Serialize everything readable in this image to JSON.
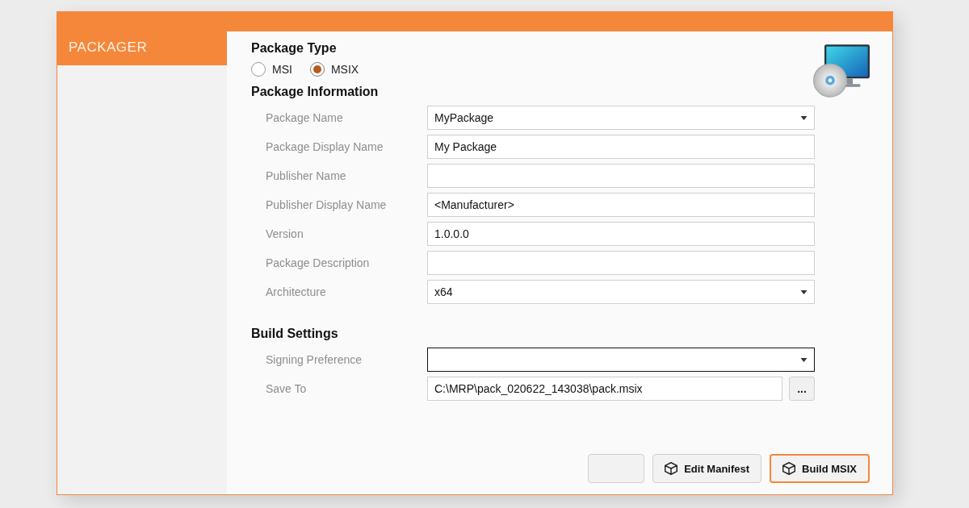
{
  "window": {
    "title": "PACKAGER"
  },
  "package_type": {
    "heading": "Package Type",
    "options": [
      {
        "label": "MSI",
        "selected": false
      },
      {
        "label": "MSIX",
        "selected": true
      }
    ]
  },
  "package_information": {
    "heading": "Package Information",
    "fields": [
      {
        "label": "Package Name",
        "kind": "dropdown",
        "value": "MyPackage",
        "focused": false
      },
      {
        "label": "Package Display Name",
        "kind": "text",
        "value": "My Package",
        "focused": false
      },
      {
        "label": "Publisher Name",
        "kind": "text",
        "focused": false
      },
      {
        "label": "Publisher Display Name",
        "kind": "text",
        "value": "<Manufacturer>",
        "focused": false
      },
      {
        "label": "Version",
        "kind": "text",
        "value": "1.0.0.0",
        "focused": false
      },
      {
        "label": "Package Description",
        "kind": "text",
        "focused": false
      },
      {
        "label": "Architecture",
        "kind": "dropdown",
        "value": "x64",
        "focused": false
      }
    ]
  },
  "build_settings": {
    "heading": "Build Settings",
    "fields": [
      {
        "label": "Signing Preference",
        "kind": "dropdown",
        "focused": true
      },
      {
        "label": "Save To",
        "kind": "browse",
        "value": "C:\\MRP\\pack_020622_143038\\pack.msix",
        "button": "...",
        "focused": false
      }
    ]
  },
  "footer": {
    "buttons": [
      {
        "default": false
      },
      {
        "label": "Edit Manifest",
        "default": false
      },
      {
        "label": "Build MSIX",
        "default": true
      }
    ]
  }
}
